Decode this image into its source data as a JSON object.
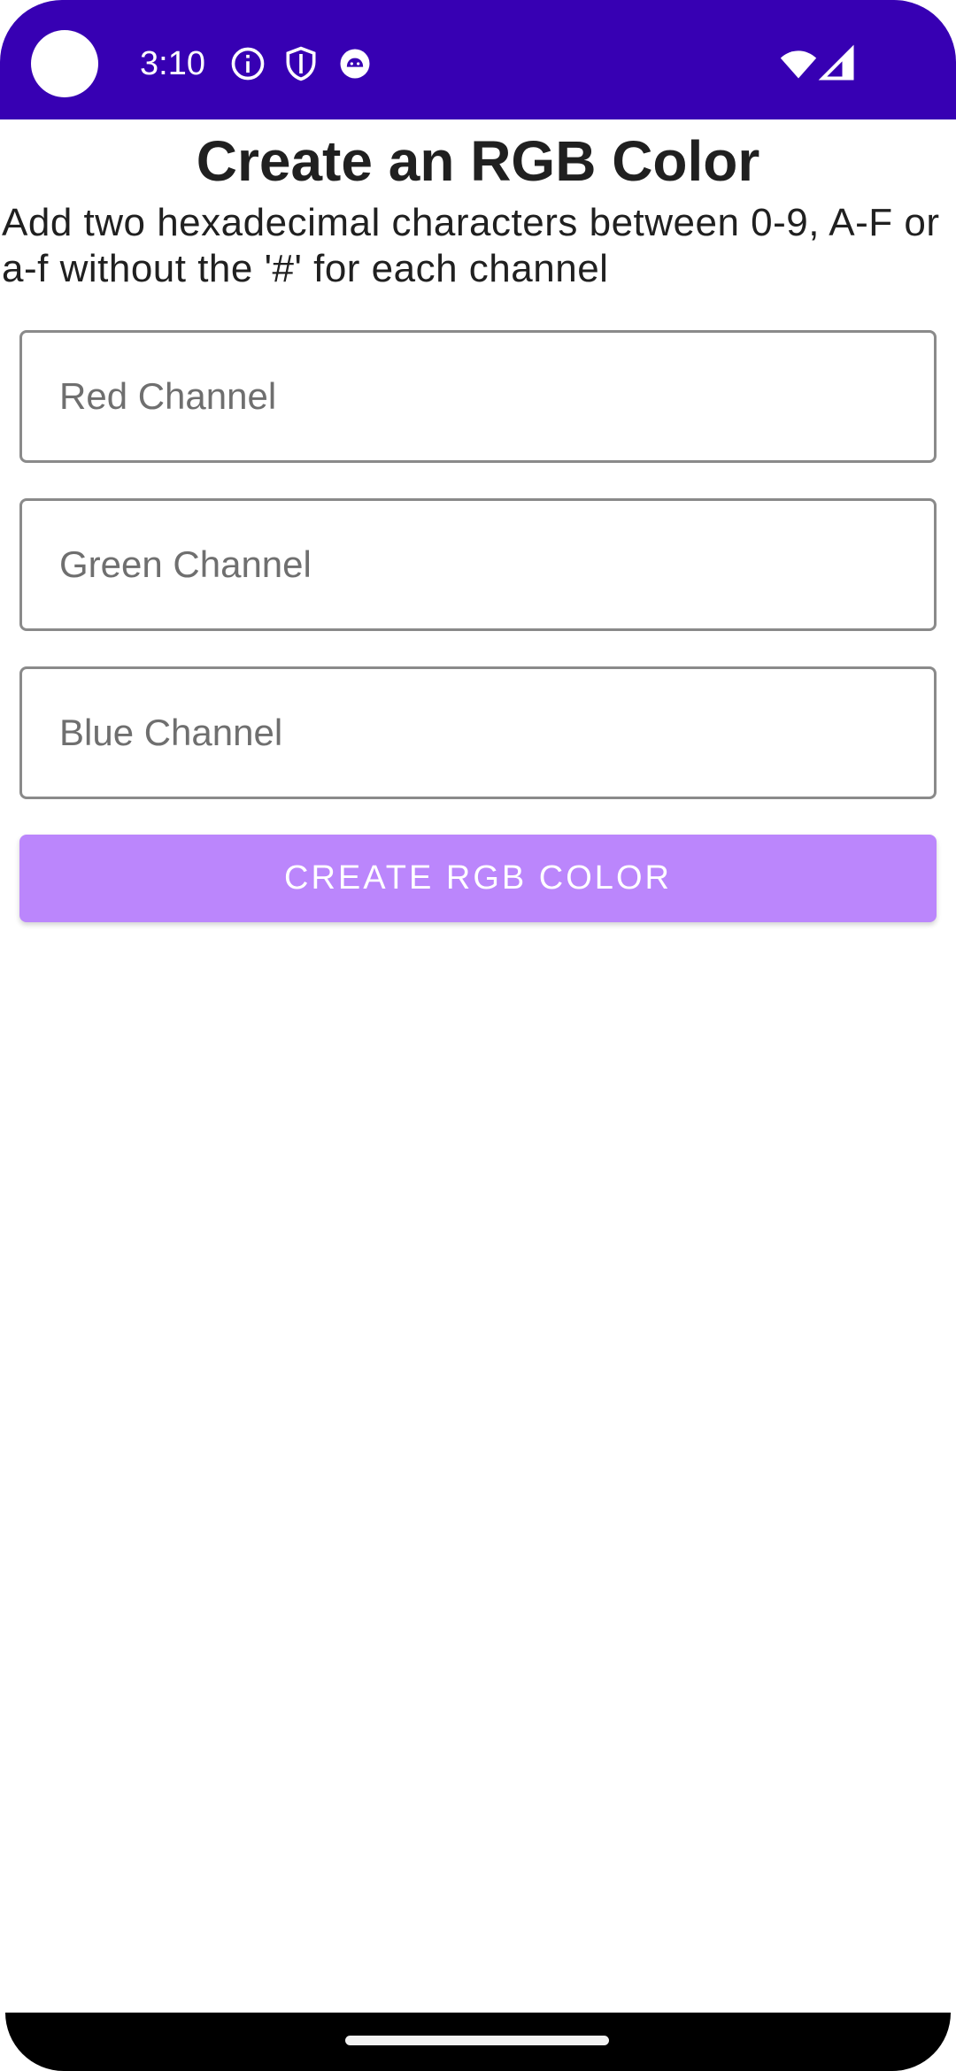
{
  "status_bar": {
    "time": "3:10",
    "color": "#3700b3",
    "icons": [
      "info-icon",
      "shield-icon",
      "android-icon",
      "wifi-icon",
      "signal-icon"
    ]
  },
  "main": {
    "title": "Create an RGB Color",
    "subtitle": "Add two hexadecimal characters between 0-9, A-F or a-f without the '#' for each channel",
    "fields": {
      "red": {
        "placeholder": "Red Channel",
        "value": ""
      },
      "green": {
        "placeholder": "Green Channel",
        "value": ""
      },
      "blue": {
        "placeholder": "Blue Channel",
        "value": ""
      }
    },
    "create_button_label": "CREATE RGB COLOR",
    "button_color": "#bb86fc"
  }
}
